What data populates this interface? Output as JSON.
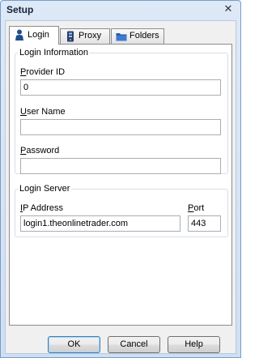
{
  "window": {
    "title": "Setup",
    "close_glyph": "✕"
  },
  "tabs": [
    {
      "label": "Login",
      "icon": "user-icon"
    },
    {
      "label": "Proxy",
      "icon": "proxy-icon"
    },
    {
      "label": "Folders",
      "icon": "folder-icon"
    }
  ],
  "login_info": {
    "legend": "Login Information",
    "provider_id": {
      "label_u": "P",
      "label_rest": "rovider ID",
      "value": "0"
    },
    "user_name": {
      "label_u": "U",
      "label_rest": "ser Name",
      "value": ""
    },
    "password": {
      "label_u": "P",
      "label_rest": "assword",
      "value": ""
    }
  },
  "login_server": {
    "legend": "Login Server",
    "ip": {
      "label_u": "I",
      "label_rest": "P Address",
      "value": "login1.theonlinetrader.com"
    },
    "port": {
      "label_u": "P",
      "label_rest": "ort",
      "value": "443"
    }
  },
  "buttons": {
    "ok": "OK",
    "cancel": "Cancel",
    "help": "Help"
  },
  "colors": {
    "title_bg": "#dde9f7",
    "focus_border": "#3c7fb1"
  }
}
